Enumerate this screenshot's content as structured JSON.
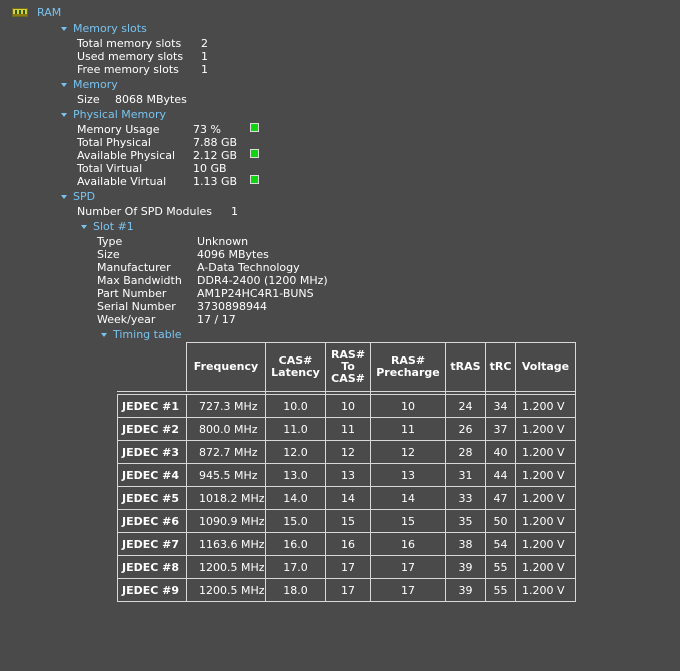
{
  "root": {
    "label": "RAM"
  },
  "memory_slots": {
    "header": "Memory slots",
    "rows": [
      {
        "label": "Total memory slots",
        "value": "2"
      },
      {
        "label": "Used memory slots",
        "value": "1"
      },
      {
        "label": "Free memory slots",
        "value": "1"
      }
    ]
  },
  "memory": {
    "header": "Memory",
    "rows": [
      {
        "label": "Size",
        "value": "8068 MBytes"
      }
    ]
  },
  "physical_memory": {
    "header": "Physical Memory",
    "rows": [
      {
        "label": "Memory Usage",
        "value": "73 %"
      },
      {
        "label": "Total Physical",
        "value": "7.88 GB"
      },
      {
        "label": "Available Physical",
        "value": "2.12 GB"
      },
      {
        "label": "Total Virtual",
        "value": "10 GB"
      },
      {
        "label": "Available Virtual",
        "value": "1.13 GB"
      }
    ],
    "indicator_color": "#10d410"
  },
  "spd": {
    "header": "SPD",
    "modules": {
      "label": "Number Of SPD Modules",
      "value": "1"
    },
    "slot": {
      "header": "Slot #1",
      "rows": [
        {
          "label": "Type",
          "value": "Unknown"
        },
        {
          "label": "Size",
          "value": "4096 MBytes"
        },
        {
          "label": "Manufacturer",
          "value": "A-Data Technology"
        },
        {
          "label": "Max Bandwidth",
          "value": "DDR4-2400 (1200 MHz)"
        },
        {
          "label": "Part Number",
          "value": "AM1P24HC4R1-BUNS"
        },
        {
          "label": "Serial Number",
          "value": "3730898944"
        },
        {
          "label": "Week/year",
          "value": "17 / 17"
        }
      ]
    },
    "timing": {
      "header": "Timing table",
      "columns": [
        "Frequency",
        "CAS# Latency",
        "RAS# To CAS#",
        "RAS# Precharge",
        "tRAS",
        "tRC",
        "Voltage"
      ],
      "rows": [
        {
          "name": "JEDEC #1",
          "freq": "727.3 MHz",
          "cas": "10.0",
          "rcd": "10",
          "rp": "10",
          "tras": "24",
          "trc": "34",
          "volt": "1.200 V"
        },
        {
          "name": "JEDEC #2",
          "freq": "800.0 MHz",
          "cas": "11.0",
          "rcd": "11",
          "rp": "11",
          "tras": "26",
          "trc": "37",
          "volt": "1.200 V"
        },
        {
          "name": "JEDEC #3",
          "freq": "872.7 MHz",
          "cas": "12.0",
          "rcd": "12",
          "rp": "12",
          "tras": "28",
          "trc": "40",
          "volt": "1.200 V"
        },
        {
          "name": "JEDEC #4",
          "freq": "945.5 MHz",
          "cas": "13.0",
          "rcd": "13",
          "rp": "13",
          "tras": "31",
          "trc": "44",
          "volt": "1.200 V"
        },
        {
          "name": "JEDEC #5",
          "freq": "1018.2 MHz",
          "cas": "14.0",
          "rcd": "14",
          "rp": "14",
          "tras": "33",
          "trc": "47",
          "volt": "1.200 V"
        },
        {
          "name": "JEDEC #6",
          "freq": "1090.9 MHz",
          "cas": "15.0",
          "rcd": "15",
          "rp": "15",
          "tras": "35",
          "trc": "50",
          "volt": "1.200 V"
        },
        {
          "name": "JEDEC #7",
          "freq": "1163.6 MHz",
          "cas": "16.0",
          "rcd": "16",
          "rp": "16",
          "tras": "38",
          "trc": "54",
          "volt": "1.200 V"
        },
        {
          "name": "JEDEC #8",
          "freq": "1200.5 MHz",
          "cas": "17.0",
          "rcd": "17",
          "rp": "17",
          "tras": "39",
          "trc": "55",
          "volt": "1.200 V"
        },
        {
          "name": "JEDEC #9",
          "freq": "1200.5 MHz",
          "cas": "18.0",
          "rcd": "17",
          "rp": "17",
          "tras": "39",
          "trc": "55",
          "volt": "1.200 V"
        }
      ]
    }
  }
}
